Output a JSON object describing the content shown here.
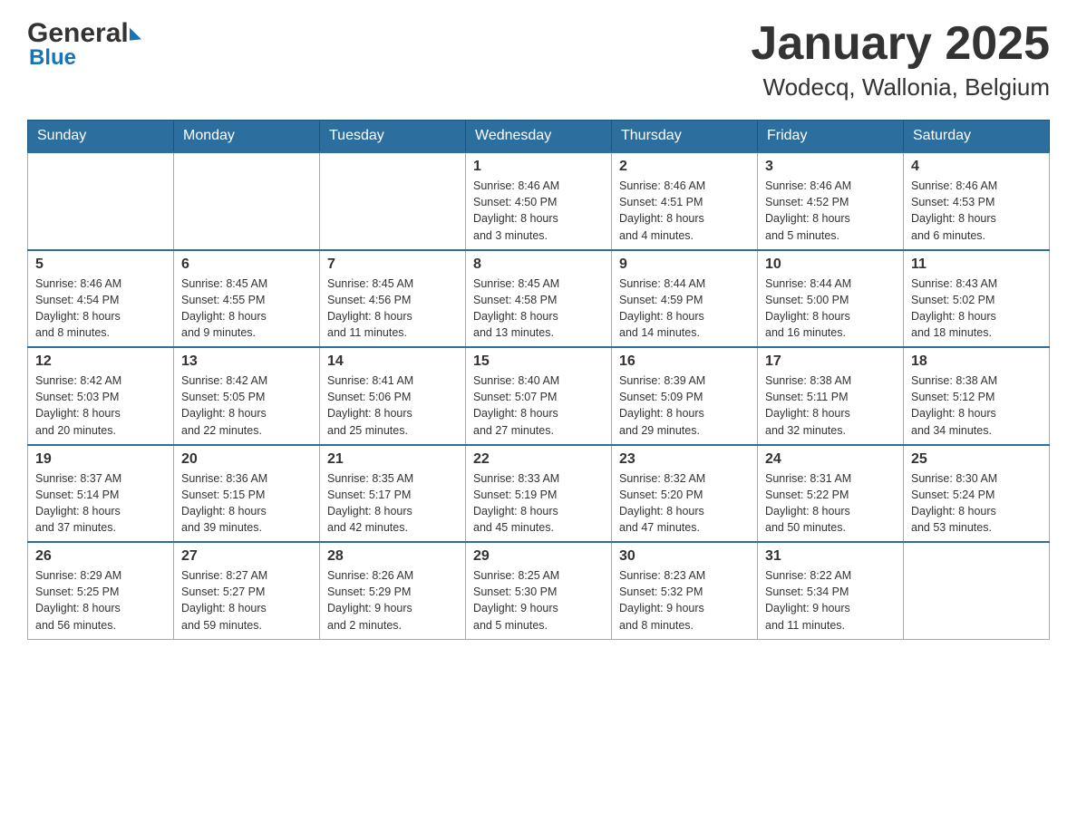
{
  "header": {
    "logo_text1": "General",
    "logo_text2": "Blue",
    "title": "January 2025",
    "subtitle": "Wodecq, Wallonia, Belgium"
  },
  "days_of_week": [
    "Sunday",
    "Monday",
    "Tuesday",
    "Wednesday",
    "Thursday",
    "Friday",
    "Saturday"
  ],
  "weeks": [
    {
      "days": [
        {
          "number": "",
          "info": ""
        },
        {
          "number": "",
          "info": ""
        },
        {
          "number": "",
          "info": ""
        },
        {
          "number": "1",
          "info": "Sunrise: 8:46 AM\nSunset: 4:50 PM\nDaylight: 8 hours\nand 3 minutes."
        },
        {
          "number": "2",
          "info": "Sunrise: 8:46 AM\nSunset: 4:51 PM\nDaylight: 8 hours\nand 4 minutes."
        },
        {
          "number": "3",
          "info": "Sunrise: 8:46 AM\nSunset: 4:52 PM\nDaylight: 8 hours\nand 5 minutes."
        },
        {
          "number": "4",
          "info": "Sunrise: 8:46 AM\nSunset: 4:53 PM\nDaylight: 8 hours\nand 6 minutes."
        }
      ]
    },
    {
      "days": [
        {
          "number": "5",
          "info": "Sunrise: 8:46 AM\nSunset: 4:54 PM\nDaylight: 8 hours\nand 8 minutes."
        },
        {
          "number": "6",
          "info": "Sunrise: 8:45 AM\nSunset: 4:55 PM\nDaylight: 8 hours\nand 9 minutes."
        },
        {
          "number": "7",
          "info": "Sunrise: 8:45 AM\nSunset: 4:56 PM\nDaylight: 8 hours\nand 11 minutes."
        },
        {
          "number": "8",
          "info": "Sunrise: 8:45 AM\nSunset: 4:58 PM\nDaylight: 8 hours\nand 13 minutes."
        },
        {
          "number": "9",
          "info": "Sunrise: 8:44 AM\nSunset: 4:59 PM\nDaylight: 8 hours\nand 14 minutes."
        },
        {
          "number": "10",
          "info": "Sunrise: 8:44 AM\nSunset: 5:00 PM\nDaylight: 8 hours\nand 16 minutes."
        },
        {
          "number": "11",
          "info": "Sunrise: 8:43 AM\nSunset: 5:02 PM\nDaylight: 8 hours\nand 18 minutes."
        }
      ]
    },
    {
      "days": [
        {
          "number": "12",
          "info": "Sunrise: 8:42 AM\nSunset: 5:03 PM\nDaylight: 8 hours\nand 20 minutes."
        },
        {
          "number": "13",
          "info": "Sunrise: 8:42 AM\nSunset: 5:05 PM\nDaylight: 8 hours\nand 22 minutes."
        },
        {
          "number": "14",
          "info": "Sunrise: 8:41 AM\nSunset: 5:06 PM\nDaylight: 8 hours\nand 25 minutes."
        },
        {
          "number": "15",
          "info": "Sunrise: 8:40 AM\nSunset: 5:07 PM\nDaylight: 8 hours\nand 27 minutes."
        },
        {
          "number": "16",
          "info": "Sunrise: 8:39 AM\nSunset: 5:09 PM\nDaylight: 8 hours\nand 29 minutes."
        },
        {
          "number": "17",
          "info": "Sunrise: 8:38 AM\nSunset: 5:11 PM\nDaylight: 8 hours\nand 32 minutes."
        },
        {
          "number": "18",
          "info": "Sunrise: 8:38 AM\nSunset: 5:12 PM\nDaylight: 8 hours\nand 34 minutes."
        }
      ]
    },
    {
      "days": [
        {
          "number": "19",
          "info": "Sunrise: 8:37 AM\nSunset: 5:14 PM\nDaylight: 8 hours\nand 37 minutes."
        },
        {
          "number": "20",
          "info": "Sunrise: 8:36 AM\nSunset: 5:15 PM\nDaylight: 8 hours\nand 39 minutes."
        },
        {
          "number": "21",
          "info": "Sunrise: 8:35 AM\nSunset: 5:17 PM\nDaylight: 8 hours\nand 42 minutes."
        },
        {
          "number": "22",
          "info": "Sunrise: 8:33 AM\nSunset: 5:19 PM\nDaylight: 8 hours\nand 45 minutes."
        },
        {
          "number": "23",
          "info": "Sunrise: 8:32 AM\nSunset: 5:20 PM\nDaylight: 8 hours\nand 47 minutes."
        },
        {
          "number": "24",
          "info": "Sunrise: 8:31 AM\nSunset: 5:22 PM\nDaylight: 8 hours\nand 50 minutes."
        },
        {
          "number": "25",
          "info": "Sunrise: 8:30 AM\nSunset: 5:24 PM\nDaylight: 8 hours\nand 53 minutes."
        }
      ]
    },
    {
      "days": [
        {
          "number": "26",
          "info": "Sunrise: 8:29 AM\nSunset: 5:25 PM\nDaylight: 8 hours\nand 56 minutes."
        },
        {
          "number": "27",
          "info": "Sunrise: 8:27 AM\nSunset: 5:27 PM\nDaylight: 8 hours\nand 59 minutes."
        },
        {
          "number": "28",
          "info": "Sunrise: 8:26 AM\nSunset: 5:29 PM\nDaylight: 9 hours\nand 2 minutes."
        },
        {
          "number": "29",
          "info": "Sunrise: 8:25 AM\nSunset: 5:30 PM\nDaylight: 9 hours\nand 5 minutes."
        },
        {
          "number": "30",
          "info": "Sunrise: 8:23 AM\nSunset: 5:32 PM\nDaylight: 9 hours\nand 8 minutes."
        },
        {
          "number": "31",
          "info": "Sunrise: 8:22 AM\nSunset: 5:34 PM\nDaylight: 9 hours\nand 11 minutes."
        },
        {
          "number": "",
          "info": ""
        }
      ]
    }
  ]
}
